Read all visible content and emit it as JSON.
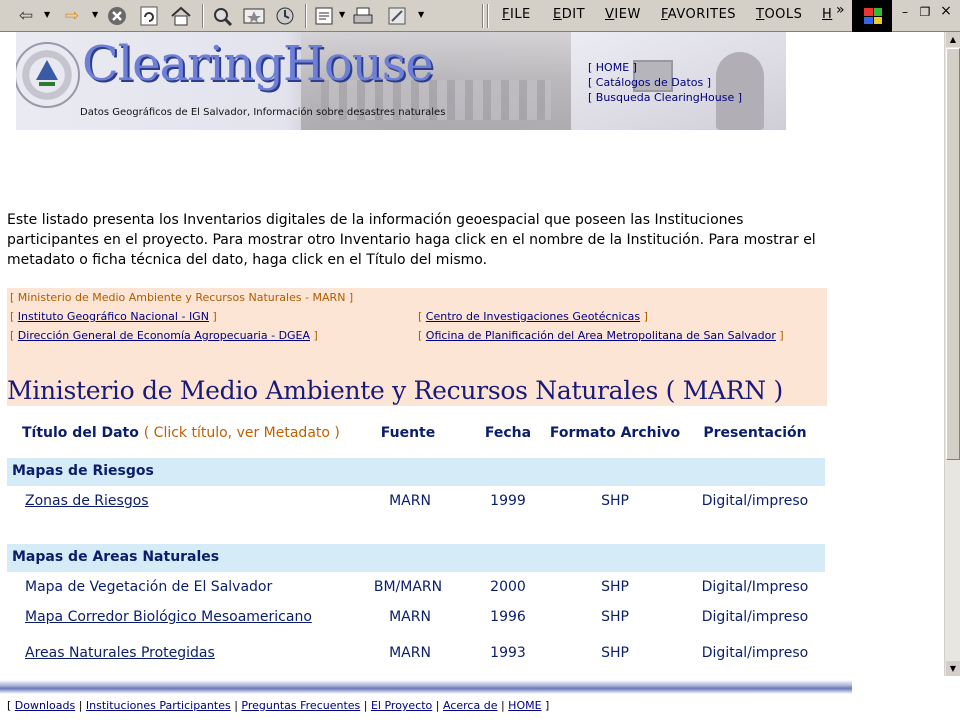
{
  "toolbar": {
    "back_icon": "⇦",
    "forward_icon": "⇨",
    "menu": [
      {
        "first": "F",
        "rest": "ILE"
      },
      {
        "first": "E",
        "rest": "DIT"
      },
      {
        "first": "V",
        "rest": "IEW"
      },
      {
        "first": "F",
        "rest": "AVORITES"
      },
      {
        "first": "T",
        "rest": "OOLS"
      },
      {
        "first": "H",
        "rest": ""
      }
    ],
    "overflow": "»",
    "minimize": "–",
    "restore": "❐",
    "close": "×"
  },
  "banner": {
    "title": "ClearingHouse",
    "subtitle": "Datos Geográficos de El Salvador, Información sobre desastres naturales",
    "links": [
      "[ HOME ]",
      "[ Catálogos de Datos ]",
      "[ Busqueda ClearingHouse ]"
    ]
  },
  "intro": "Este listado presenta los Inventarios digitales de la información geoespacial que poseen las Instituciones participantes en el proyecto. Para mostrar otro Inventario haga click en el nombre de la Institución. Para mostrar el metadato o ficha técnica del dato, haga click en el Título del mismo.",
  "institutions": {
    "current": "[ Ministerio de Medio Ambiente y Recursos Naturales - MARN ]",
    "others": [
      "Instituto Geográfico Nacional - IGN",
      "Centro de Investigaciones Geotécnicas",
      "Dirección General de Economía Agropecuaria - DGEA",
      "Oficina de Planificación del Area Metropolitana de San Salvador"
    ],
    "heading": "Ministerio de Medio Ambiente y Recursos Naturales ( MARN )"
  },
  "table": {
    "headers": {
      "title": "Título del Dato",
      "title_note": "( Click título, ver Metadato )",
      "title_close": ")",
      "source": "Fuente",
      "date": "Fecha",
      "format": "Formato Archivo",
      "presentation": "Presentación"
    },
    "categories": [
      "Mapas de Riesgos",
      "Mapas de Areas Naturales"
    ],
    "rows": [
      {
        "title": "Zonas de Riesgos",
        "source": "MARN",
        "date": "1999",
        "format": "SHP",
        "presentation": "Digital/impreso"
      },
      {
        "title": "Mapa de Vegetación de El Salvador",
        "source": "BM/MARN",
        "date": "2000",
        "format": "SHP",
        "presentation": "Digital/Impreso"
      },
      {
        "title": "Mapa Corredor Biológico Mesoamericano",
        "source": "MARN",
        "date": "1996",
        "format": "SHP",
        "presentation": "Digital/impreso"
      },
      {
        "title": "Areas Naturales Protegidas",
        "source": "MARN",
        "date": "1993",
        "format": "SHP",
        "presentation": "Digital/impreso"
      }
    ]
  },
  "footer": {
    "links": [
      "Downloads",
      "Instituciones Participantes",
      "Preguntas Frecuentes",
      "El Proyecto",
      "Acerca de",
      "HOME"
    ]
  }
}
